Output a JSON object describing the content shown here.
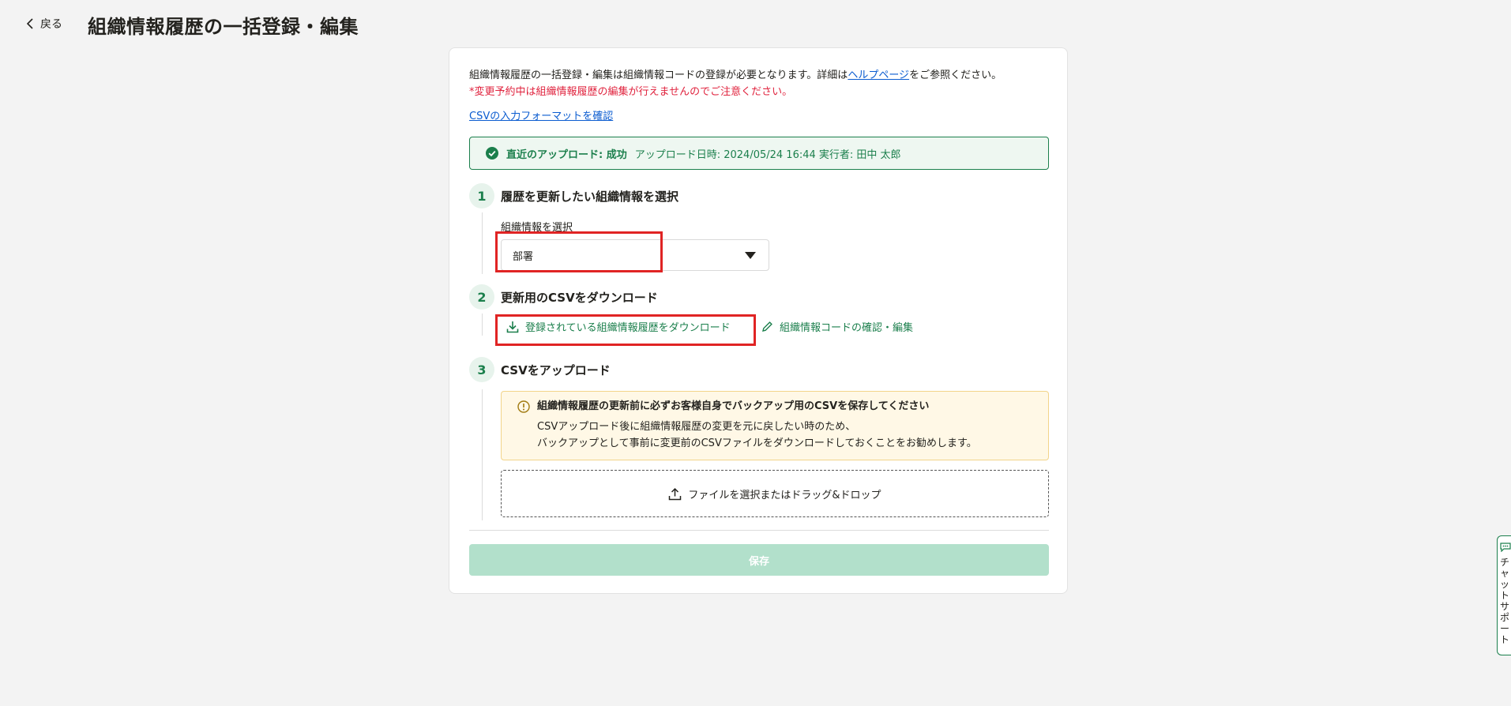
{
  "header": {
    "back_label": "戻る",
    "title": "組織情報履歴の一括登録・編集"
  },
  "intro": {
    "text_before_link": "組織情報履歴の一括登録・編集は組織情報コードの登録が必要となります。詳細は",
    "help_link": "ヘルプページ",
    "text_after_link": "をご参照ください。",
    "warning": "*変更予約中は組織情報履歴の編集が行えませんのでご注意ください。",
    "format_link": "CSVの入力フォーマットを確認"
  },
  "status": {
    "label": "直近のアップロード: 成功",
    "meta": "アップロード日時: 2024/05/24 16:44  実行者: 田中 太郎",
    "color": "#1b7f4c"
  },
  "steps": [
    {
      "number": "1",
      "title": "履歴を更新したい組織情報を選択"
    },
    {
      "number": "2",
      "title": "更新用のCSVをダウンロード"
    },
    {
      "number": "3",
      "title": "CSVをアップロード"
    }
  ],
  "select": {
    "label": "組織情報を選択",
    "value": "部署"
  },
  "download": {
    "download_label": "登録されている組織情報履歴をダウンロード",
    "edit_label": "組織情報コードの確認・編集"
  },
  "notice": {
    "title": "組織情報履歴の更新前に必ずお客様自身でバックアップ用のCSVを保存してください",
    "line1": "CSVアップロード後に組織情報履歴の変更を元に戻したい時のため、",
    "line2": "バックアップとして事前に変更前のCSVファイルをダウンロードしておくことをお勧めします。"
  },
  "upload": {
    "label": "ファイルを選択またはドラッグ&ドロップ"
  },
  "save_label": "保存",
  "chat": {
    "label": "チャットサポート"
  },
  "colors": {
    "accent": "#1b7f4c",
    "highlight": "#e02424",
    "save_disabled": "#b2e0cb"
  }
}
